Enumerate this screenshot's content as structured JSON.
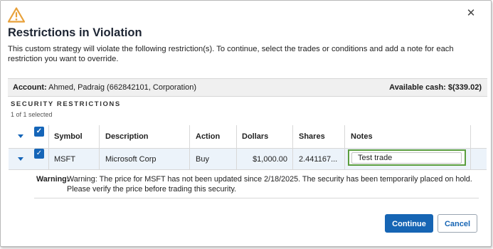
{
  "dialog": {
    "title": "Restrictions in Violation",
    "intro": "This custom strategy will violate the following restriction(s). To continue, select the trades or conditions and add a note for each restriction you want to override.",
    "close_glyph": "✕",
    "warning_icon": "warning-triangle-icon",
    "accent_color": "#1565b8"
  },
  "account": {
    "label": "Account:",
    "value": "Ahmed, Padraig (662842101, Corporation)",
    "cash_label": "Available cash:",
    "cash_value": "$(339.02)"
  },
  "section": {
    "title": "SECURITY RESTRICTIONS",
    "selected": "1 of 1 selected"
  },
  "table": {
    "columns": [
      "Symbol",
      "Description",
      "Action",
      "Dollars",
      "Shares",
      "Notes"
    ],
    "rows": [
      {
        "checked": true,
        "symbol": "MSFT",
        "description": "Microsoft Corp",
        "action": "Buy",
        "dollars": "$1,000.00",
        "shares": "2.441167...",
        "notes": "Test trade"
      }
    ]
  },
  "warning": {
    "label": "Warning:",
    "text": "Warning: The price for MSFT has not been updated since 2/18/2025. The security has been temporarily placed on hold. Please verify the price before trading this security."
  },
  "buttons": {
    "continue": "Continue",
    "cancel": "Cancel"
  }
}
